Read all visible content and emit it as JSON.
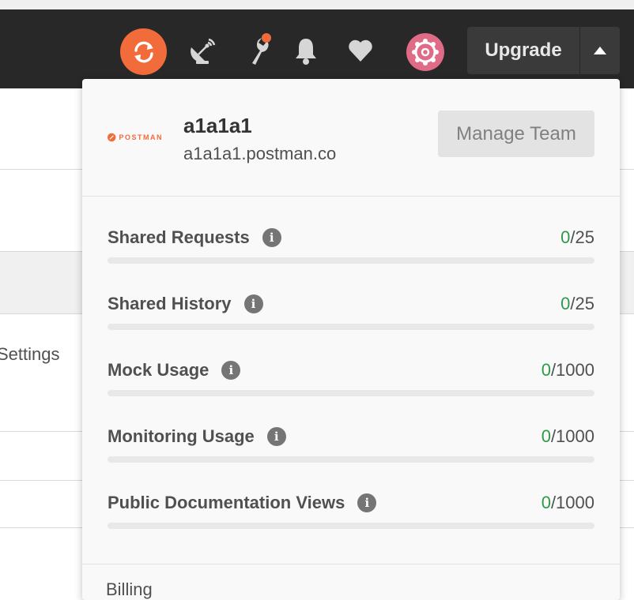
{
  "header": {
    "upgrade_label": "Upgrade",
    "icons": [
      "sync-icon",
      "satellite-icon",
      "wrench-icon",
      "bell-icon",
      "heart-icon",
      "gear-avatar-icon",
      "caret-up-icon"
    ],
    "accent": "#f26b3a",
    "notification_dot": "#f26b3a"
  },
  "background": {
    "settings_label": "Settings"
  },
  "team": {
    "logo_text": "POSTMAN",
    "name": "a1a1a1",
    "domain": "a1a1a1.postman.co",
    "manage_label": "Manage Team"
  },
  "usage": [
    {
      "label": "Shared Requests",
      "used": "0",
      "limit": "/25",
      "fraction": 0
    },
    {
      "label": "Shared History",
      "used": "0",
      "limit": "/25",
      "fraction": 0
    },
    {
      "label": "Mock Usage",
      "used": "0",
      "limit": "/1000",
      "fraction": 0
    },
    {
      "label": "Monitoring Usage",
      "used": "0",
      "limit": "/1000",
      "fraction": 0
    },
    {
      "label": "Public Documentation Views",
      "used": "0",
      "limit": "/1000",
      "fraction": 0
    }
  ],
  "billing_label": "Billing",
  "colors": {
    "used_green": "#2e9a48",
    "topbar": "#282828"
  }
}
